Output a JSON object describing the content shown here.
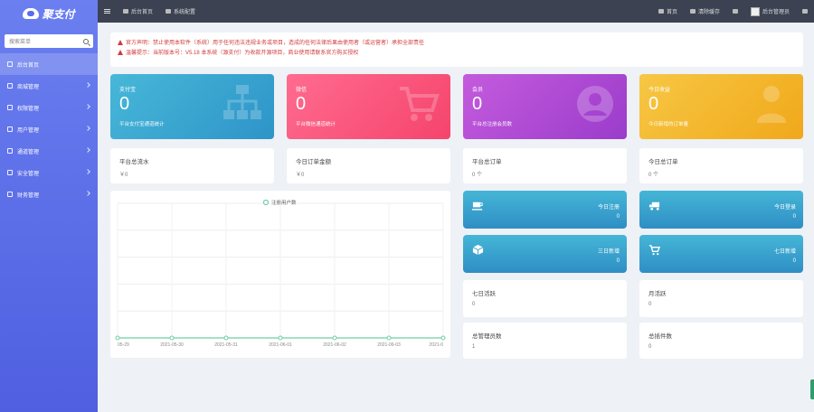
{
  "app": {
    "logo_text": "聚支付",
    "search_placeholder": "搜索菜单"
  },
  "sidebar": {
    "items": [
      {
        "label": "后台首页",
        "active": true,
        "icon": "home-icon"
      },
      {
        "label": "商城管理",
        "icon": "grid-icon"
      },
      {
        "label": "权限管理",
        "icon": "key-icon"
      },
      {
        "label": "用户管理",
        "icon": "user-icon"
      },
      {
        "label": "通道管理",
        "icon": "channel-icon"
      },
      {
        "label": "安全管理",
        "icon": "shield-icon"
      },
      {
        "label": "财务管理",
        "icon": "money-icon"
      }
    ]
  },
  "topbar": {
    "tabs": [
      "后台首页",
      "系统配置"
    ],
    "right": {
      "home": "首页",
      "clear_cache": "清除缓存",
      "user": "后台管理员"
    }
  },
  "notice": {
    "line1": "官方声明：禁止使用本软件（系统）用于任何违法违规业务或项目，造成的任何法律后果由使用者（或运营者）承担全部责任",
    "line2": "温馨提示：当前版本号：V5.18 本系统（源支付）为收款开源项目，商业使用请联系官方购买授权"
  },
  "stat_cards": [
    {
      "label": "支付宝",
      "value": "0",
      "sub": "平台支付宝通道统计",
      "color_from": "#47b8d8",
      "color_to": "#2e94c9"
    },
    {
      "label": "微信",
      "value": "0",
      "sub": "平台微信通道统计",
      "color_from": "#ff6b8f",
      "color_to": "#f5446d"
    },
    {
      "label": "会员",
      "value": "0",
      "sub": "平台总注册会员数",
      "color_from": "#c45bdd",
      "color_to": "#9b3ccb"
    },
    {
      "label": "今日收益",
      "value": "0",
      "sub": "今日新增的订单量",
      "color_from": "#f7c744",
      "color_to": "#f0a81a"
    }
  ],
  "info_cards": [
    {
      "label": "平台总流水",
      "value": "￥0"
    },
    {
      "label": "今日订单金额",
      "value": "￥0"
    },
    {
      "label": "平台总订单",
      "value": "0 个"
    },
    {
      "label": "今日总订单",
      "value": "0 个"
    }
  ],
  "mini_cards": [
    {
      "label": "今日注册",
      "value": "0",
      "icon": "coffee-cup-icon"
    },
    {
      "label": "今日登录",
      "value": "0",
      "icon": "truck-icon"
    },
    {
      "label": "三日新增",
      "value": "0",
      "icon": "cube-icon"
    },
    {
      "label": "七日新增",
      "value": "0",
      "icon": "cart-icon"
    }
  ],
  "bottom_cards": [
    {
      "label": "七日活跃",
      "value": "0"
    },
    {
      "label": "月活跃",
      "value": "0"
    },
    {
      "label": "总管理员数",
      "value": "1"
    },
    {
      "label": "总插件数",
      "value": "0"
    }
  ],
  "chart_data": {
    "type": "line",
    "legend": [
      "注册用户数"
    ],
    "x": [
      "05-29",
      "2021-05-30",
      "2021-05-31",
      "2021-06-01",
      "2021-06-02",
      "2021-06-03",
      "2021-0"
    ],
    "series": [
      {
        "name": "注册用户数",
        "values": [
          0,
          0,
          0,
          0,
          0,
          0,
          0
        ]
      }
    ],
    "color": "#6fcfa3",
    "grid": true,
    "legend_position": "top"
  }
}
